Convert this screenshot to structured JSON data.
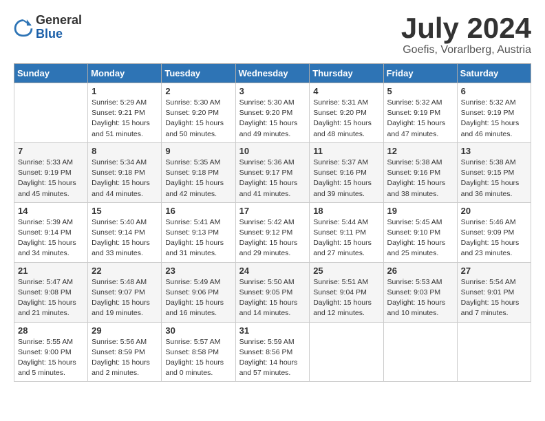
{
  "header": {
    "logo_general": "General",
    "logo_blue": "Blue",
    "month": "July 2024",
    "location": "Goefis, Vorarlberg, Austria"
  },
  "columns": [
    "Sunday",
    "Monday",
    "Tuesday",
    "Wednesday",
    "Thursday",
    "Friday",
    "Saturday"
  ],
  "weeks": [
    [
      {
        "day": "",
        "info": ""
      },
      {
        "day": "1",
        "info": "Sunrise: 5:29 AM\nSunset: 9:21 PM\nDaylight: 15 hours\nand 51 minutes."
      },
      {
        "day": "2",
        "info": "Sunrise: 5:30 AM\nSunset: 9:20 PM\nDaylight: 15 hours\nand 50 minutes."
      },
      {
        "day": "3",
        "info": "Sunrise: 5:30 AM\nSunset: 9:20 PM\nDaylight: 15 hours\nand 49 minutes."
      },
      {
        "day": "4",
        "info": "Sunrise: 5:31 AM\nSunset: 9:20 PM\nDaylight: 15 hours\nand 48 minutes."
      },
      {
        "day": "5",
        "info": "Sunrise: 5:32 AM\nSunset: 9:19 PM\nDaylight: 15 hours\nand 47 minutes."
      },
      {
        "day": "6",
        "info": "Sunrise: 5:32 AM\nSunset: 9:19 PM\nDaylight: 15 hours\nand 46 minutes."
      }
    ],
    [
      {
        "day": "7",
        "info": "Sunrise: 5:33 AM\nSunset: 9:19 PM\nDaylight: 15 hours\nand 45 minutes."
      },
      {
        "day": "8",
        "info": "Sunrise: 5:34 AM\nSunset: 9:18 PM\nDaylight: 15 hours\nand 44 minutes."
      },
      {
        "day": "9",
        "info": "Sunrise: 5:35 AM\nSunset: 9:18 PM\nDaylight: 15 hours\nand 42 minutes."
      },
      {
        "day": "10",
        "info": "Sunrise: 5:36 AM\nSunset: 9:17 PM\nDaylight: 15 hours\nand 41 minutes."
      },
      {
        "day": "11",
        "info": "Sunrise: 5:37 AM\nSunset: 9:16 PM\nDaylight: 15 hours\nand 39 minutes."
      },
      {
        "day": "12",
        "info": "Sunrise: 5:38 AM\nSunset: 9:16 PM\nDaylight: 15 hours\nand 38 minutes."
      },
      {
        "day": "13",
        "info": "Sunrise: 5:38 AM\nSunset: 9:15 PM\nDaylight: 15 hours\nand 36 minutes."
      }
    ],
    [
      {
        "day": "14",
        "info": "Sunrise: 5:39 AM\nSunset: 9:14 PM\nDaylight: 15 hours\nand 34 minutes."
      },
      {
        "day": "15",
        "info": "Sunrise: 5:40 AM\nSunset: 9:14 PM\nDaylight: 15 hours\nand 33 minutes."
      },
      {
        "day": "16",
        "info": "Sunrise: 5:41 AM\nSunset: 9:13 PM\nDaylight: 15 hours\nand 31 minutes."
      },
      {
        "day": "17",
        "info": "Sunrise: 5:42 AM\nSunset: 9:12 PM\nDaylight: 15 hours\nand 29 minutes."
      },
      {
        "day": "18",
        "info": "Sunrise: 5:44 AM\nSunset: 9:11 PM\nDaylight: 15 hours\nand 27 minutes."
      },
      {
        "day": "19",
        "info": "Sunrise: 5:45 AM\nSunset: 9:10 PM\nDaylight: 15 hours\nand 25 minutes."
      },
      {
        "day": "20",
        "info": "Sunrise: 5:46 AM\nSunset: 9:09 PM\nDaylight: 15 hours\nand 23 minutes."
      }
    ],
    [
      {
        "day": "21",
        "info": "Sunrise: 5:47 AM\nSunset: 9:08 PM\nDaylight: 15 hours\nand 21 minutes."
      },
      {
        "day": "22",
        "info": "Sunrise: 5:48 AM\nSunset: 9:07 PM\nDaylight: 15 hours\nand 19 minutes."
      },
      {
        "day": "23",
        "info": "Sunrise: 5:49 AM\nSunset: 9:06 PM\nDaylight: 15 hours\nand 16 minutes."
      },
      {
        "day": "24",
        "info": "Sunrise: 5:50 AM\nSunset: 9:05 PM\nDaylight: 15 hours\nand 14 minutes."
      },
      {
        "day": "25",
        "info": "Sunrise: 5:51 AM\nSunset: 9:04 PM\nDaylight: 15 hours\nand 12 minutes."
      },
      {
        "day": "26",
        "info": "Sunrise: 5:53 AM\nSunset: 9:03 PM\nDaylight: 15 hours\nand 10 minutes."
      },
      {
        "day": "27",
        "info": "Sunrise: 5:54 AM\nSunset: 9:01 PM\nDaylight: 15 hours\nand 7 minutes."
      }
    ],
    [
      {
        "day": "28",
        "info": "Sunrise: 5:55 AM\nSunset: 9:00 PM\nDaylight: 15 hours\nand 5 minutes."
      },
      {
        "day": "29",
        "info": "Sunrise: 5:56 AM\nSunset: 8:59 PM\nDaylight: 15 hours\nand 2 minutes."
      },
      {
        "day": "30",
        "info": "Sunrise: 5:57 AM\nSunset: 8:58 PM\nDaylight: 15 hours\nand 0 minutes."
      },
      {
        "day": "31",
        "info": "Sunrise: 5:59 AM\nSunset: 8:56 PM\nDaylight: 14 hours\nand 57 minutes."
      },
      {
        "day": "",
        "info": ""
      },
      {
        "day": "",
        "info": ""
      },
      {
        "day": "",
        "info": ""
      }
    ]
  ]
}
